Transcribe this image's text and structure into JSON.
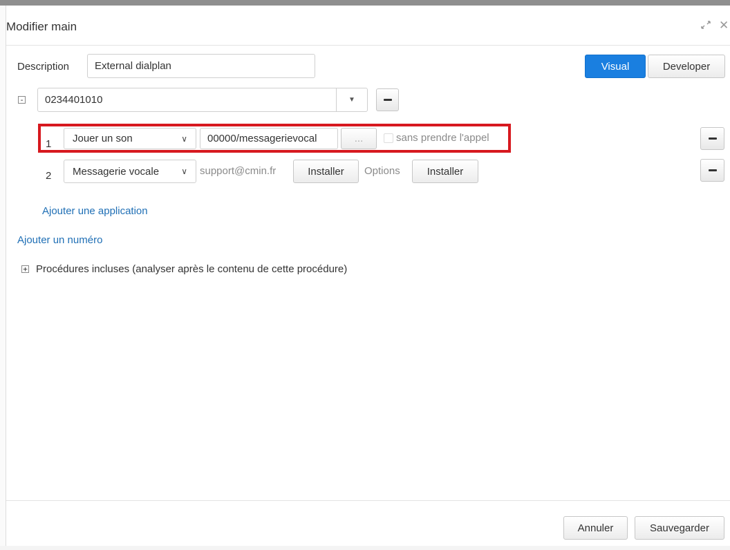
{
  "dialog": {
    "title": "Modifier main",
    "description_label": "Description",
    "description_value": "External dialplan",
    "mode_visual": "Visual",
    "mode_developer": "Developer"
  },
  "number": {
    "value": "0234401010",
    "toggle": "-"
  },
  "apps": [
    {
      "index": "1",
      "type": "Jouer un son",
      "file": "00000/messagerievocal",
      "browse": "...",
      "checkbox_label": "sans prendre l'appel",
      "checked": false
    },
    {
      "index": "2",
      "type": "Messagerie vocale",
      "email": "support@cmin.fr",
      "install1": "Installer",
      "options_label": "Options",
      "install2": "Installer"
    }
  ],
  "links": {
    "add_app": "Ajouter une application",
    "add_number": "Ajouter un numéro"
  },
  "includes": {
    "toggle": "+",
    "label": "Procédures incluses (analyser après le contenu de cette procédure)"
  },
  "footer": {
    "cancel": "Annuler",
    "save": "Sauvegarder"
  },
  "colors": {
    "primary": "#1a7fe0",
    "highlight": "#d7191f",
    "link": "#1f6fb5"
  }
}
